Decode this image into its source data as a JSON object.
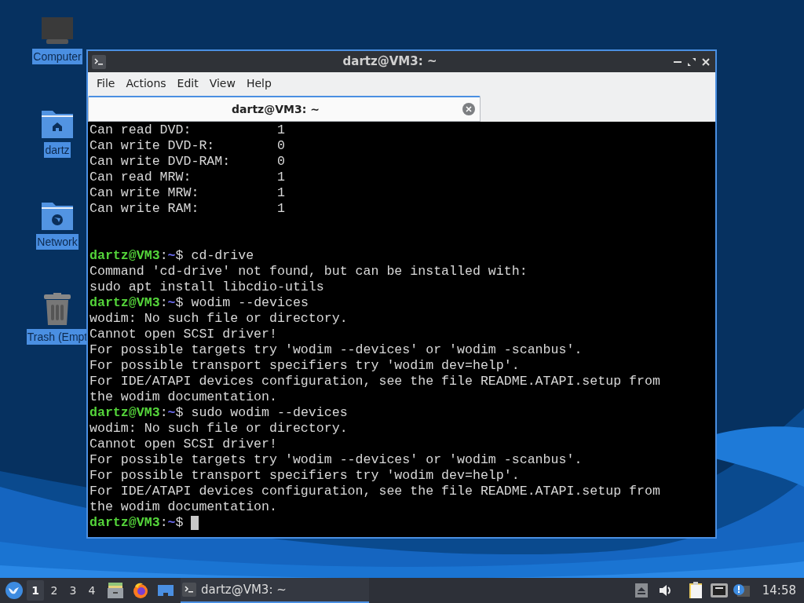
{
  "desktop_icons": [
    {
      "label": "Computer",
      "kind": "computer"
    },
    {
      "label": "dartz",
      "kind": "home"
    },
    {
      "label": "Network",
      "kind": "network"
    },
    {
      "label": "Trash (Empt",
      "kind": "trash"
    }
  ],
  "window": {
    "title": "dartz@VM3: ~",
    "menu": [
      "File",
      "Actions",
      "Edit",
      "View",
      "Help"
    ],
    "tabs": [
      {
        "label": "dartz@VM3: ~",
        "selected": true
      }
    ],
    "terminal": [
      {
        "kind": "output",
        "text": "Can read DVD:           1"
      },
      {
        "kind": "output",
        "text": "Can write DVD-R:        0"
      },
      {
        "kind": "output",
        "text": "Can write DVD-RAM:      0"
      },
      {
        "kind": "output",
        "text": "Can read MRW:           1"
      },
      {
        "kind": "output",
        "text": "Can write MRW:          1"
      },
      {
        "kind": "output",
        "text": "Can write RAM:          1"
      },
      {
        "kind": "blank"
      },
      {
        "kind": "blank"
      },
      {
        "kind": "prompt",
        "user": "dartz@VM3",
        "separator": ":",
        "path": "~",
        "symbol": "$",
        "command": "cd-drive",
        "cursor": false
      },
      {
        "kind": "output",
        "text": "Command 'cd-drive' not found, but can be installed with:"
      },
      {
        "kind": "output",
        "text": "sudo apt install libcdio-utils"
      },
      {
        "kind": "prompt",
        "user": "dartz@VM3",
        "separator": ":",
        "path": "~",
        "symbol": "$",
        "command": "wodim --devices",
        "cursor": false
      },
      {
        "kind": "output",
        "text": "wodim: No such file or directory."
      },
      {
        "kind": "output",
        "text": "Cannot open SCSI driver!"
      },
      {
        "kind": "output",
        "text": "For possible targets try 'wodim --devices' or 'wodim -scanbus'."
      },
      {
        "kind": "output",
        "text": "For possible transport specifiers try 'wodim dev=help'."
      },
      {
        "kind": "output",
        "text": "For IDE/ATAPI devices configuration, see the file README.ATAPI.setup from"
      },
      {
        "kind": "output",
        "text": "the wodim documentation."
      },
      {
        "kind": "prompt",
        "user": "dartz@VM3",
        "separator": ":",
        "path": "~",
        "symbol": "$",
        "command": "sudo wodim --devices",
        "cursor": false
      },
      {
        "kind": "output",
        "text": "wodim: No such file or directory."
      },
      {
        "kind": "output",
        "text": "Cannot open SCSI driver!"
      },
      {
        "kind": "output",
        "text": "For possible targets try 'wodim --devices' or 'wodim -scanbus'."
      },
      {
        "kind": "output",
        "text": "For possible transport specifiers try 'wodim dev=help'."
      },
      {
        "kind": "output",
        "text": "For IDE/ATAPI devices configuration, see the file README.ATAPI.setup from"
      },
      {
        "kind": "output",
        "text": "the wodim documentation."
      },
      {
        "kind": "prompt",
        "user": "dartz@VM3",
        "separator": ":",
        "path": "~",
        "symbol": "$",
        "cursor": true
      }
    ]
  },
  "taskbar": {
    "workspaces": [
      {
        "label": "1",
        "selected": true
      },
      {
        "label": "2",
        "selected": false
      },
      {
        "label": "3",
        "selected": false
      },
      {
        "label": "4",
        "selected": false
      }
    ],
    "tasks": [
      {
        "label": "dartz@VM3: ~",
        "selected": true
      }
    ],
    "clock": "14:58"
  }
}
